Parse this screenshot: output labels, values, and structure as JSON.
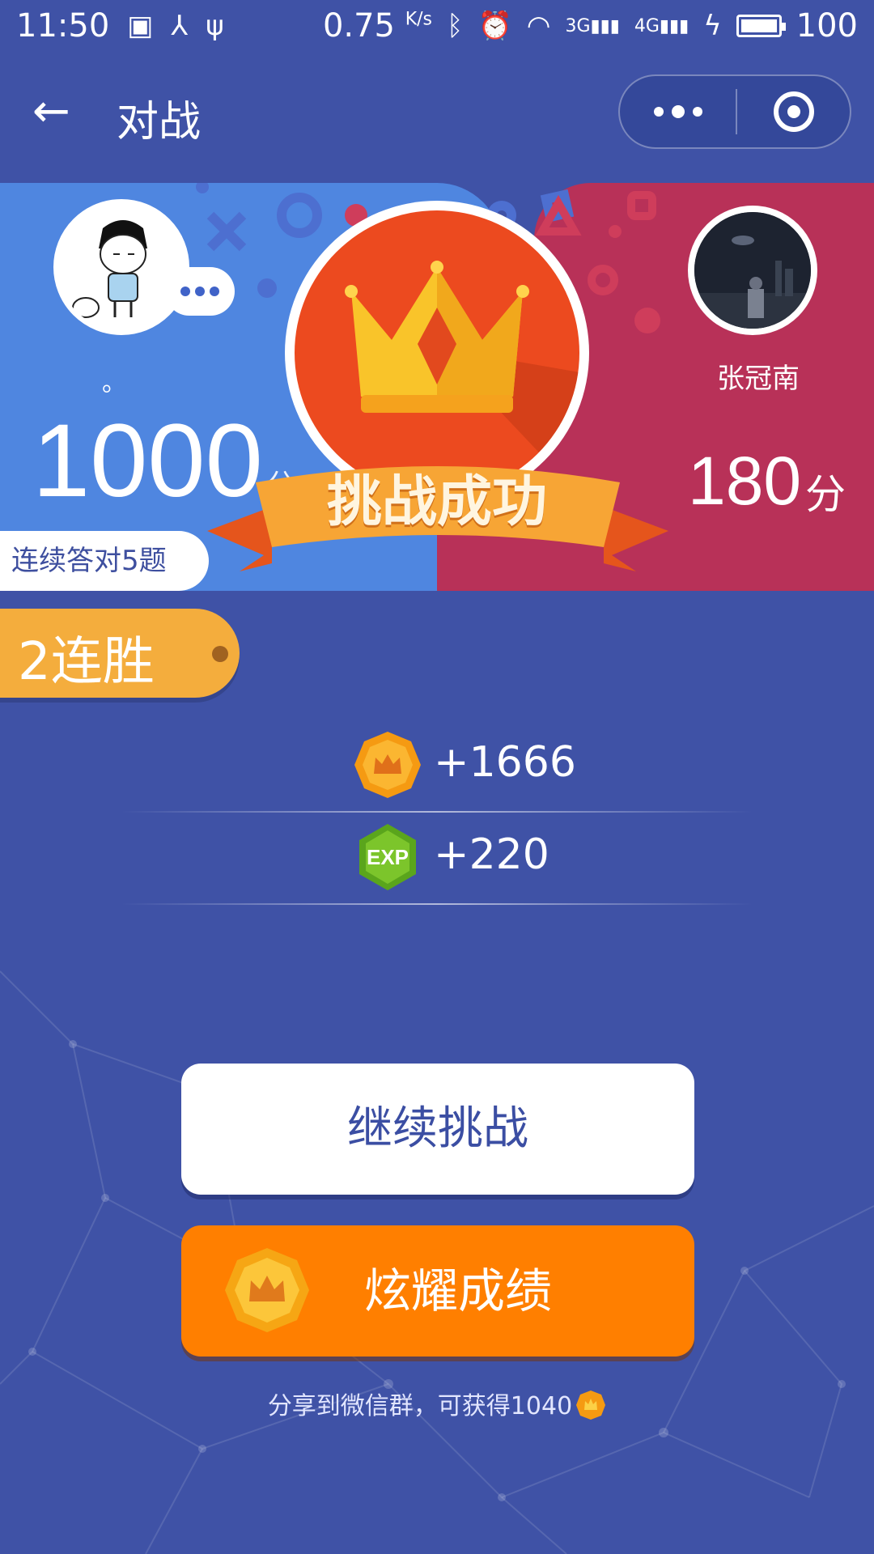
{
  "status_bar": {
    "time": "11:50",
    "speed": "0.75",
    "speed_unit": "K/s",
    "net1": "3G",
    "net2": "4G",
    "battery": "100"
  },
  "nav": {
    "title": "对战"
  },
  "battle": {
    "left_player": {
      "name": "。",
      "score": "1000",
      "score_unit": "分"
    },
    "right_player": {
      "name": "张冠南",
      "score": "180",
      "score_unit": "分"
    },
    "streak_label": "连续答对5题",
    "result_label": "挑战成功"
  },
  "win_tag": "2连胜",
  "rewards": [
    {
      "icon": "crown-coin-icon",
      "value": "+1666"
    },
    {
      "icon": "exp-icon",
      "value": "+220",
      "badge": "EXP"
    }
  ],
  "buttons": {
    "continue_label": "继续挑战",
    "share_label": "炫耀成绩"
  },
  "share_hint": "分享到微信群，可获得1040",
  "colors": {
    "background": "#3f52a6",
    "left_panel": "#4f86e0",
    "right_panel": "#b83158",
    "medal": "#ec4a1f",
    "share_button": "#ff7f00",
    "win_tag": "#f4ad3d"
  }
}
